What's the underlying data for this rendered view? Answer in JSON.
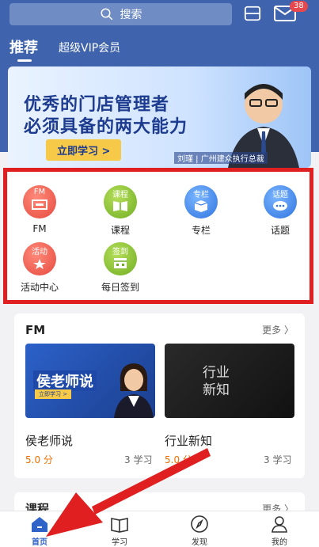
{
  "header": {
    "search_placeholder": "搜索",
    "mail_badge": "38",
    "tabs": [
      {
        "label": "推荐"
      },
      {
        "label": "超级VIP会员"
      }
    ]
  },
  "banner": {
    "line1": "优秀的门店管理者",
    "line2": "必须具备的两大能力",
    "button": "立即学习 >",
    "caption": "刘瑾 | 广州建众执行总裁"
  },
  "grid": {
    "items": [
      {
        "badge": "FM",
        "label": "FM",
        "color": "#e5493d",
        "icon": "fm-icon"
      },
      {
        "badge": "课程",
        "label": "课程",
        "color": "#6fae22",
        "icon": "course-icon"
      },
      {
        "badge": "专栏",
        "label": "专栏",
        "color": "#2f74e0",
        "icon": "column-icon"
      },
      {
        "badge": "话题",
        "label": "话题",
        "color": "#2f74e0",
        "icon": "topic-icon"
      },
      {
        "badge": "活动",
        "label": "活动中心",
        "color": "#e5493d",
        "icon": "activity-icon"
      },
      {
        "badge": "签到",
        "label": "每日签到",
        "color": "#6fae22",
        "icon": "checkin-icon"
      }
    ]
  },
  "fm": {
    "title": "FM",
    "more": "更多 〉",
    "items": [
      {
        "thumb_title": "侯老师说",
        "thumb_sub": "立即学习 >",
        "name": "侯老师说",
        "score": "5.0 分",
        "learners": "3 学习"
      },
      {
        "thumb_title": "行业新知",
        "name": "行业新知",
        "score": "5.0 分",
        "learners": "3 学习"
      }
    ]
  },
  "next_section": {
    "title": "课程",
    "more": "更多 〉"
  },
  "tabbar": {
    "items": [
      {
        "label": "首页",
        "icon": "home-icon",
        "active": true
      },
      {
        "label": "学习",
        "icon": "book-icon"
      },
      {
        "label": "发现",
        "icon": "compass-icon"
      },
      {
        "label": "我的",
        "icon": "user-icon"
      }
    ]
  },
  "colors": {
    "primary": "#3f63ad",
    "highlight_frame": "#e02020",
    "accent": "#f07000"
  }
}
